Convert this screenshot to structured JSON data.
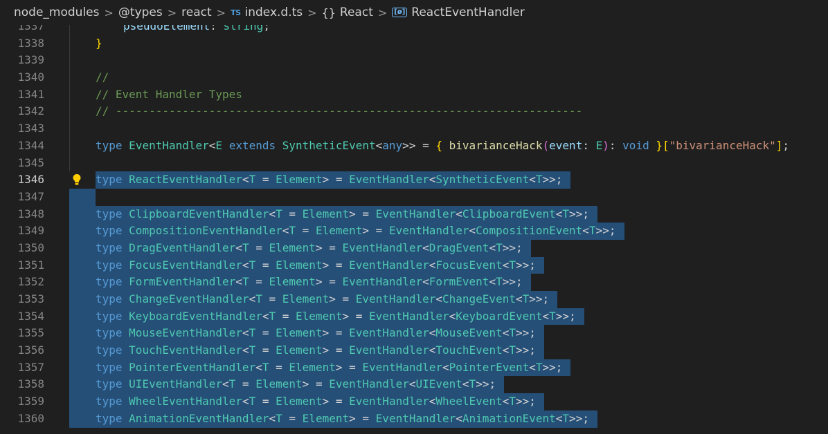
{
  "breadcrumb": {
    "items": [
      "node_modules",
      "@types",
      "react",
      "index.d.ts",
      "React",
      "ReactEventHandler"
    ],
    "ts_icon": "TS",
    "namespace_icon": "{}",
    "variable_icon": "[ø]",
    "separator": ">"
  },
  "colors": {
    "background": "#1f1f1f",
    "selection": "#264f78",
    "keyword": "#569cd6",
    "type": "#4ec9b0",
    "comment": "#6a9955"
  },
  "editor": {
    "active_line": "1346",
    "lines": [
      {
        "num": "1337",
        "text": "pseudoElement: string;"
      },
      {
        "num": "1338",
        "text": "}"
      },
      {
        "num": "1339",
        "text": ""
      },
      {
        "num": "1340",
        "text": "//"
      },
      {
        "num": "1341",
        "text": "// Event Handler Types"
      },
      {
        "num": "1342",
        "text": "// ----------------------------------------------------------------------"
      },
      {
        "num": "1343",
        "text": ""
      },
      {
        "num": "1344",
        "text": "type EventHandler<E extends SyntheticEvent<any>> = { bivarianceHack(event: E): void }[\"bivarianceHack\"];"
      },
      {
        "num": "1345",
        "text": ""
      },
      {
        "num": "1346",
        "text": "type ReactEventHandler<T = Element> = EventHandler<SyntheticEvent<T>>;"
      },
      {
        "num": "1347",
        "text": ""
      },
      {
        "num": "1348",
        "text": "type ClipboardEventHandler<T = Element> = EventHandler<ClipboardEvent<T>>;"
      },
      {
        "num": "1349",
        "text": "type CompositionEventHandler<T = Element> = EventHandler<CompositionEvent<T>>;"
      },
      {
        "num": "1350",
        "text": "type DragEventHandler<T = Element> = EventHandler<DragEvent<T>>;"
      },
      {
        "num": "1351",
        "text": "type FocusEventHandler<T = Element> = EventHandler<FocusEvent<T>>;"
      },
      {
        "num": "1352",
        "text": "type FormEventHandler<T = Element> = EventHandler<FormEvent<T>>;"
      },
      {
        "num": "1353",
        "text": "type ChangeEventHandler<T = Element> = EventHandler<ChangeEvent<T>>;"
      },
      {
        "num": "1354",
        "text": "type KeyboardEventHandler<T = Element> = EventHandler<KeyboardEvent<T>>;"
      },
      {
        "num": "1355",
        "text": "type MouseEventHandler<T = Element> = EventHandler<MouseEvent<T>>;"
      },
      {
        "num": "1356",
        "text": "type TouchEventHandler<T = Element> = EventHandler<TouchEvent<T>>;"
      },
      {
        "num": "1357",
        "text": "type PointerEventHandler<T = Element> = EventHandler<PointerEvent<T>>;"
      },
      {
        "num": "1358",
        "text": "type UIEventHandler<T = Element> = EventHandler<UIEvent<T>>;"
      },
      {
        "num": "1359",
        "text": "type WheelEventHandler<T = Element> = EventHandler<WheelEvent<T>>;"
      },
      {
        "num": "1360",
        "text": "type AnimationEventHandler<T = Element> = EventHandler<AnimationEvent<T>>;"
      }
    ]
  }
}
